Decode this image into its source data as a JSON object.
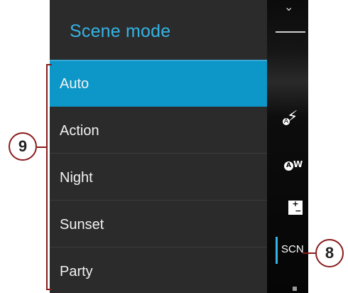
{
  "menu": {
    "title": "Scene mode",
    "items": [
      {
        "label": "Auto",
        "selected": true
      },
      {
        "label": "Action",
        "selected": false
      },
      {
        "label": "Night",
        "selected": false
      },
      {
        "label": "Sunset",
        "selected": false
      },
      {
        "label": "Party",
        "selected": false
      }
    ]
  },
  "sidebar": {
    "scene_label": "SCN",
    "white_balance_label": "W",
    "auto_badge": "A",
    "icons": [
      "chevron-down-icon",
      "flash-auto-icon",
      "white-balance-auto-icon",
      "exposure-icon"
    ]
  },
  "callouts": {
    "nine": "9",
    "eight": "8"
  },
  "colors": {
    "accent": "#34b4e4",
    "selected_bg": "#0d97c8",
    "menu_bg": "#2b2b2b",
    "callout": "#8a1c1c"
  }
}
